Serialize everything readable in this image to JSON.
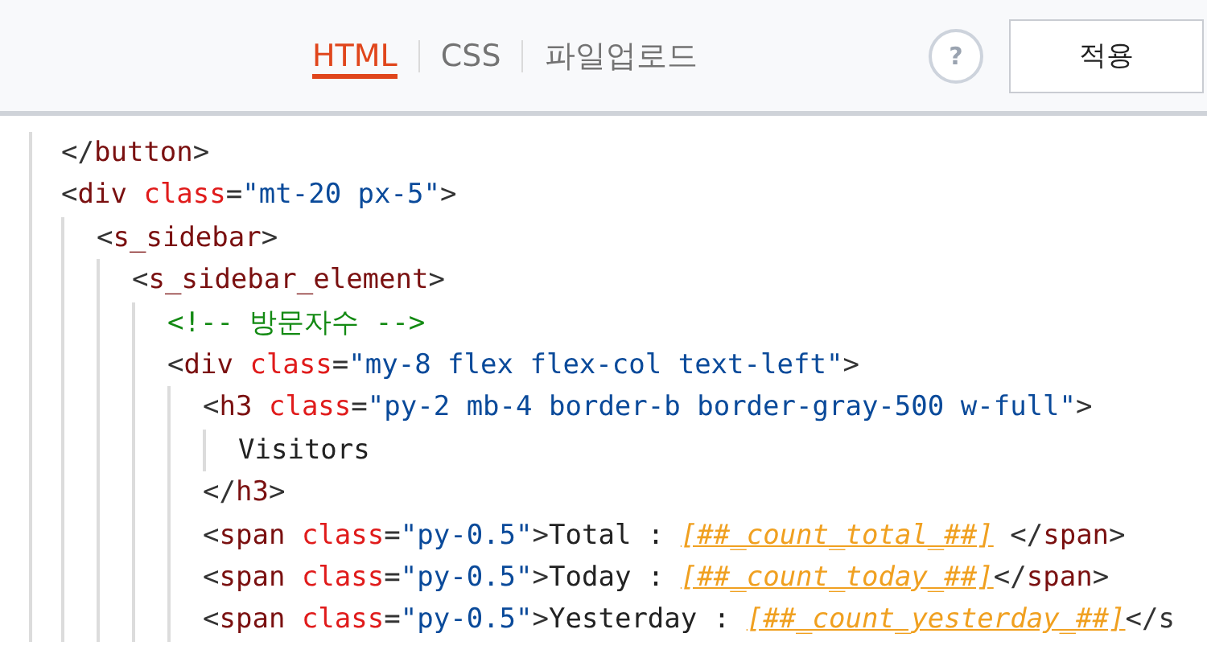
{
  "tabs": [
    {
      "label": "HTML",
      "selected": true
    },
    {
      "label": "CSS",
      "selected": false
    },
    {
      "label": "파일업로드",
      "selected": false
    }
  ],
  "help_button": {
    "label": "?"
  },
  "apply_button": {
    "label": "적용"
  },
  "code": [
    {
      "tokens": [
        {
          "kind": "punct",
          "text": "</"
        },
        {
          "kind": "tag",
          "text": "button"
        },
        {
          "kind": "punct",
          "text": ">"
        }
      ]
    },
    {
      "tokens": [
        {
          "kind": "punct",
          "text": "<"
        },
        {
          "kind": "tag",
          "text": "div"
        },
        {
          "kind": "attr",
          "text": " class"
        },
        {
          "kind": "punct",
          "text": "="
        },
        {
          "kind": "string",
          "text": "\"mt-20 px-5\""
        },
        {
          "kind": "punct",
          "text": ">"
        }
      ],
      "children": [
        {
          "tokens": [
            {
              "kind": "punct",
              "text": "<"
            },
            {
              "kind": "tag",
              "text": "s_sidebar"
            },
            {
              "kind": "punct",
              "text": ">"
            }
          ],
          "children": [
            {
              "tokens": [
                {
                  "kind": "punct",
                  "text": "<"
                },
                {
                  "kind": "tag",
                  "text": "s_sidebar_element"
                },
                {
                  "kind": "punct",
                  "text": ">"
                }
              ],
              "children": [
                {
                  "tokens": [
                    {
                      "kind": "comment",
                      "text": "<!-- 방문자수 -->"
                    }
                  ]
                },
                {
                  "tokens": [
                    {
                      "kind": "punct",
                      "text": "<"
                    },
                    {
                      "kind": "tag",
                      "text": "div"
                    },
                    {
                      "kind": "attr",
                      "text": " class"
                    },
                    {
                      "kind": "punct",
                      "text": "="
                    },
                    {
                      "kind": "string",
                      "text": "\"my-8 flex flex-col text-left\""
                    },
                    {
                      "kind": "punct",
                      "text": ">"
                    }
                  ],
                  "children": [
                    {
                      "tokens": [
                        {
                          "kind": "punct",
                          "text": "<"
                        },
                        {
                          "kind": "tag",
                          "text": "h3"
                        },
                        {
                          "kind": "attr",
                          "text": " class"
                        },
                        {
                          "kind": "punct",
                          "text": "="
                        },
                        {
                          "kind": "string",
                          "text": "\"py-2 mb-4 border-b border-gray-500 w-full\""
                        },
                        {
                          "kind": "punct",
                          "text": ">"
                        }
                      ],
                      "children": [
                        {
                          "tokens": [
                            {
                              "kind": "text",
                              "text": "Visitors"
                            }
                          ]
                        }
                      ]
                    },
                    {
                      "tokens": [
                        {
                          "kind": "punct",
                          "text": "</"
                        },
                        {
                          "kind": "tag",
                          "text": "h3"
                        },
                        {
                          "kind": "punct",
                          "text": ">"
                        }
                      ]
                    },
                    {
                      "tokens": [
                        {
                          "kind": "punct",
                          "text": "<"
                        },
                        {
                          "kind": "tag",
                          "text": "span"
                        },
                        {
                          "kind": "attr",
                          "text": " class"
                        },
                        {
                          "kind": "punct",
                          "text": "="
                        },
                        {
                          "kind": "string",
                          "text": "\"py-0.5\""
                        },
                        {
                          "kind": "punct",
                          "text": ">"
                        },
                        {
                          "kind": "text",
                          "text": "Total : "
                        },
                        {
                          "kind": "template",
                          "text": "[##_count_total_##]"
                        },
                        {
                          "kind": "punct",
                          "text": " </"
                        },
                        {
                          "kind": "tag",
                          "text": "span"
                        },
                        {
                          "kind": "punct",
                          "text": ">"
                        }
                      ]
                    },
                    {
                      "tokens": [
                        {
                          "kind": "punct",
                          "text": "<"
                        },
                        {
                          "kind": "tag",
                          "text": "span"
                        },
                        {
                          "kind": "attr",
                          "text": " class"
                        },
                        {
                          "kind": "punct",
                          "text": "="
                        },
                        {
                          "kind": "string",
                          "text": "\"py-0.5\""
                        },
                        {
                          "kind": "punct",
                          "text": ">"
                        },
                        {
                          "kind": "text",
                          "text": "Today : "
                        },
                        {
                          "kind": "template",
                          "text": "[##_count_today_##]"
                        },
                        {
                          "kind": "punct",
                          "text": "</"
                        },
                        {
                          "kind": "tag",
                          "text": "span"
                        },
                        {
                          "kind": "punct",
                          "text": ">"
                        }
                      ]
                    },
                    {
                      "tokens": [
                        {
                          "kind": "punct",
                          "text": "<"
                        },
                        {
                          "kind": "tag",
                          "text": "span"
                        },
                        {
                          "kind": "attr",
                          "text": " class"
                        },
                        {
                          "kind": "punct",
                          "text": "="
                        },
                        {
                          "kind": "string",
                          "text": "\"py-0.5\""
                        },
                        {
                          "kind": "punct",
                          "text": ">"
                        },
                        {
                          "kind": "text",
                          "text": "Yesterday : "
                        },
                        {
                          "kind": "template",
                          "text": "[##_count_yesterday_##]"
                        },
                        {
                          "kind": "punct",
                          "text": "</s"
                        }
                      ]
                    }
                  ]
                }
              ]
            }
          ]
        }
      ]
    }
  ]
}
